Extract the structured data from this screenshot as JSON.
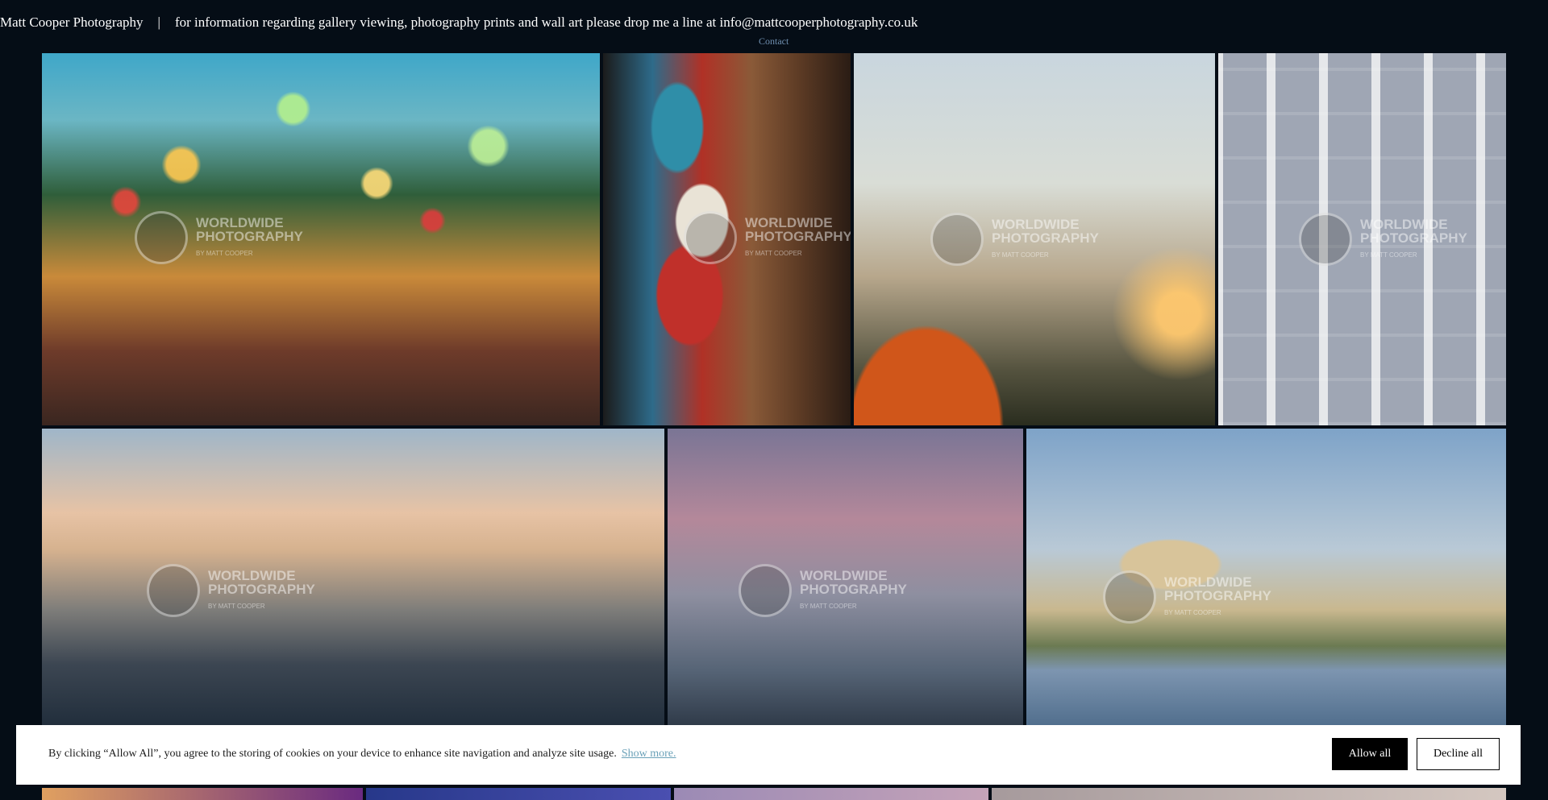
{
  "header": {
    "site_name": "Matt Cooper Photography",
    "separator": "|",
    "info_text": "for information regarding gallery viewing, photography prints and wall art please drop me a line at info@mattcooperphotography.co.uk",
    "contact_label": "Contact"
  },
  "gallery": {
    "watermark_title_line1": "WORLDWIDE",
    "watermark_title_line2": "PHOTOGRAPHY",
    "watermark_byline": "BY MATT COOPER"
  },
  "cookie_banner": {
    "message": "By clicking “Allow All”, you agree to the storing of cookies on your device to enhance site navigation and analyze site usage.",
    "show_more_label": "Show more.",
    "allow_label": "Allow all",
    "decline_label": "Decline all"
  },
  "colors": {
    "background": "#050d16",
    "link": "#6aa1b8",
    "contact_link": "#6f8fb0"
  }
}
